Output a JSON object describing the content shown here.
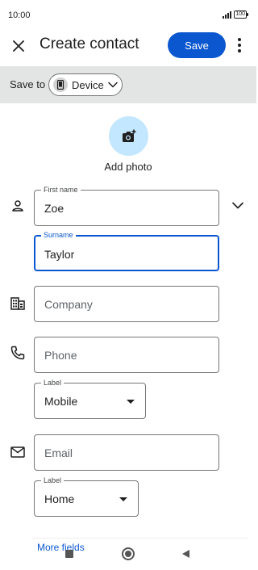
{
  "status_bar": {
    "time": "10:00",
    "battery": "100"
  },
  "app_bar": {
    "title": "Create contact",
    "save_label": "Save",
    "close_icon": "close-icon",
    "more_icon": "more-vert-icon"
  },
  "save_to": {
    "label": "Save to",
    "account": "Device"
  },
  "photo": {
    "label": "Add photo",
    "icon": "add-photo-icon"
  },
  "fields": {
    "first_name": {
      "label": "First name",
      "value": "Zoe"
    },
    "surname": {
      "label": "Surname",
      "value": "Taylor"
    },
    "company": {
      "placeholder": "Company"
    },
    "phone": {
      "placeholder": "Phone"
    },
    "phone_label": {
      "label": "Label",
      "value": "Mobile"
    },
    "email": {
      "placeholder": "Email"
    },
    "email_label": {
      "label": "Label",
      "value": "Home"
    }
  },
  "more_fields": "More fields",
  "colors": {
    "accent": "#0b57d0",
    "photo_bg": "#c2e7ff",
    "saveto_bg": "#e3e5e4"
  }
}
